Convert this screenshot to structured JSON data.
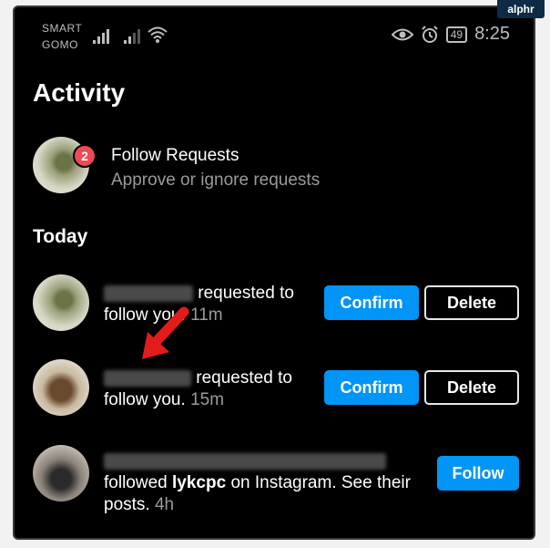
{
  "watermark": "alphr",
  "status": {
    "carrier_line1": "SMART",
    "carrier_line2": "GOMO",
    "battery": "49",
    "time": "8:25"
  },
  "page": {
    "title": "Activity"
  },
  "follow_requests": {
    "title": "Follow Requests",
    "subtitle": "Approve or ignore requests",
    "badge": "2"
  },
  "section_today": "Today",
  "notifications": [
    {
      "text_a": "requested to",
      "text_b": "follow you.",
      "time": "11m",
      "confirm": "Confirm",
      "delete": "Delete"
    },
    {
      "text_a": "requested to",
      "text_b": "follow you.",
      "time": "15m",
      "confirm": "Confirm",
      "delete": "Delete"
    },
    {
      "text_pre": "followed",
      "user": "lykcpc",
      "text_post": "on Instagram. See their",
      "text_b": "posts.",
      "time": "4h",
      "follow": "Follow"
    }
  ],
  "colors": {
    "accent": "#0095f6",
    "badge": "#ed4956",
    "arrow": "#e31b1b"
  },
  "icons": [
    "signal-icon",
    "wifi-icon",
    "eye-icon",
    "alarm-icon",
    "battery-icon",
    "arrow-icon"
  ]
}
